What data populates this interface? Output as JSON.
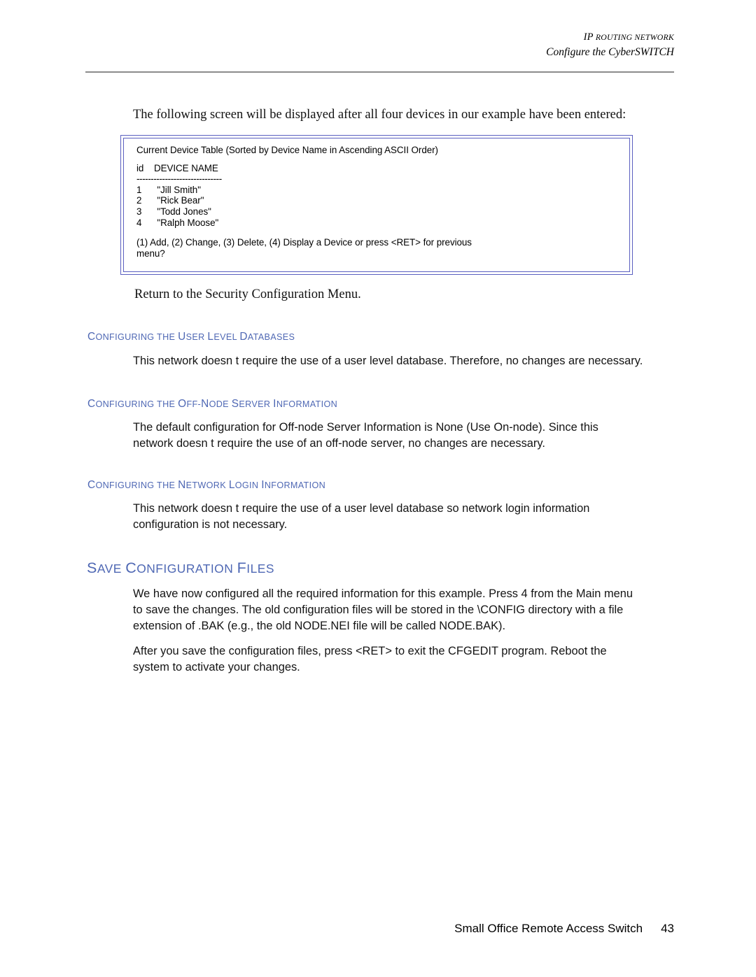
{
  "header": {
    "line1_lead": "IP",
    "line1_rest": "ROUTING NETWORK",
    "line2": "Configure the CyberSWITCH"
  },
  "intro_paragraph": "The following screen will be displayed after all four devices in our example have been entered:",
  "screen_box": {
    "title": "Current Device Table (Sorted by Device Name in Ascending ASCII Order)",
    "col_header": "id    DEVICE NAME",
    "separator": "------------------------------",
    "rows": [
      "1      \"Jill Smith\"",
      "2      \"Rick Bear\"",
      "3      \"Todd Jones\"",
      "4      \"Ralph Moose\""
    ],
    "prompt_line1": "(1) Add, (2) Change, (3) Delete, (4) Display a Device or press <RET> for previous",
    "prompt_line2": "menu?"
  },
  "return_paragraph": "Return to the Security Configuration Menu.",
  "sections": [
    {
      "heading_lead": "C",
      "heading_rest": "ONFIGURING THE ",
      "heading_full_parts": [
        "C",
        "ONFIGURING THE ",
        "U",
        "SER ",
        "L",
        "EVEL ",
        "D",
        "ATABASES"
      ],
      "body_lines": [
        "This network doesn t require the use of a user level database. Therefore, no changes are necessary."
      ]
    },
    {
      "heading_full_parts": [
        "C",
        "ONFIGURING THE ",
        "O",
        "FF-",
        "N",
        "ODE ",
        "S",
        "ERVER ",
        "I",
        "NFORMATION"
      ],
      "body_lines": [
        "The default configuration for Off-node Server Information is None (Use On-node). Since this",
        "network doesn t require the use of an off-node server, no changes are necessary."
      ]
    },
    {
      "heading_full_parts": [
        "C",
        "ONFIGURING THE ",
        "N",
        "ETWORK ",
        "L",
        "OGIN ",
        "I",
        "NFORMATION"
      ],
      "body_lines": [
        "This network doesn t require the use of a user level database so network login information",
        "configuration is not necessary."
      ]
    }
  ],
  "save_section": {
    "heading_parts": [
      "S",
      "AVE ",
      "C",
      "ONFIGURATION ",
      "F",
      "ILES"
    ],
    "paragraph_1_lines": [
      "We have now configured all the required information for this example. Press 4 from the Main menu",
      "to save the changes. The old configuration files will be stored in the \\CONFIG directory with a file",
      "extension of .BAK (e.g., the old NODE.NEI file will be called NODE.BAK)."
    ],
    "paragraph_2_lines": [
      "After you save the configuration files, press <RET> to exit the CFGEDIT program. Reboot the",
      "system to activate your changes."
    ]
  },
  "footer": {
    "text": "Small Office Remote Access Switch",
    "page_number": "43"
  },
  "colors": {
    "heading_blue": "#4f68b4",
    "box_border": "#5a5fc0",
    "header_rule": "#8c8c8c"
  }
}
